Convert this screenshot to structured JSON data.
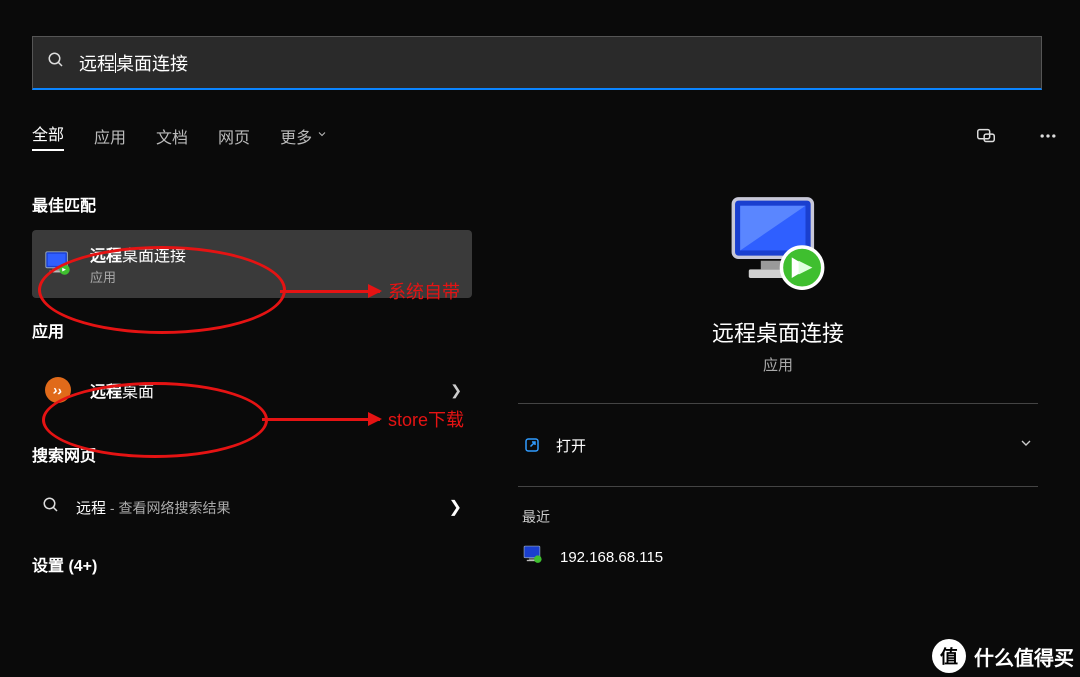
{
  "search": {
    "query": "远程桌面连接",
    "prefix": "远程",
    "rest": "桌面连接"
  },
  "tabs": {
    "all": "全部",
    "apps": "应用",
    "docs": "文档",
    "web": "网页",
    "more": "更多"
  },
  "sections": {
    "best_match": "最佳匹配",
    "apps": "应用",
    "web": "搜索网页",
    "settings": "设置 (4+)"
  },
  "results": {
    "rdp": {
      "title_bold": "远程",
      "title_rest": "桌面连接",
      "sub": "应用"
    },
    "store": {
      "title_bold": "远程",
      "title_rest": "桌面"
    },
    "websearch": {
      "term": "远程",
      "sep": " - ",
      "hint": "查看网络搜索结果"
    }
  },
  "detail": {
    "title": "远程桌面连接",
    "sub": "应用",
    "open": "打开",
    "recent_head": "最近",
    "recent_item": "192.168.68.115"
  },
  "annotations": {
    "builtin": "系统自带",
    "store": "store下载"
  },
  "watermark": {
    "badge": "值",
    "text": "什么值得买"
  },
  "colors": {
    "accent": "#0a84ff",
    "anno": "#e51313",
    "open_icon": "#2f9bff"
  },
  "icons": {
    "search": "search-icon",
    "chevron_down": "chevron-down-icon",
    "chat": "chat-icon",
    "more": "more-icon",
    "rdp": "rdp-monitor-icon",
    "store": "remote-desktop-store-icon",
    "chevron_right": "chevron-right-icon",
    "open": "open-external-icon"
  }
}
